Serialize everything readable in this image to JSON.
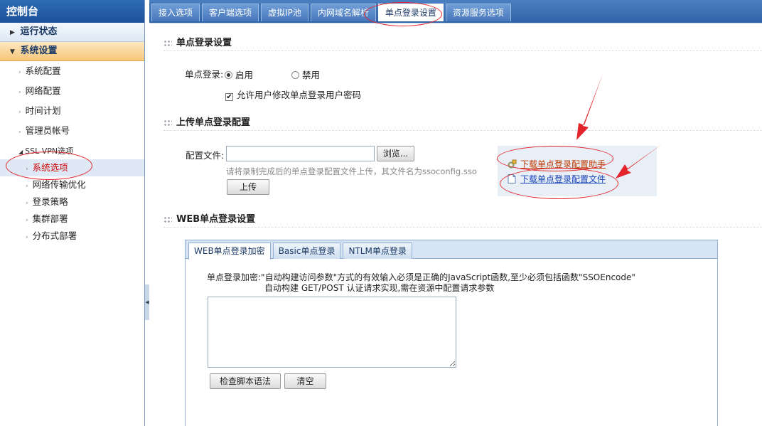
{
  "sidebar": {
    "title": "控制台",
    "section_status": "运行状态",
    "section_settings": "系统设置",
    "items": [
      "系统配置",
      "网络配置",
      "时间计划",
      "管理员帐号"
    ],
    "group_label": "SSL VPN选项",
    "sub_items": [
      "系统选项",
      "网络传输优化",
      "登录策略",
      "集群部署",
      "分布式部署"
    ]
  },
  "tabs": [
    "接入选项",
    "客户端选项",
    "虚拟IP池",
    "内网域名解析",
    "单点登录设置",
    "资源服务选项"
  ],
  "sso": {
    "section_title": "单点登录设置",
    "label": "单点登录:",
    "enable_label": "启用",
    "disable_label": "禁用",
    "selected": "启用",
    "allow_change_pwd": "允许用户修改单点登录用户密码"
  },
  "upload": {
    "section_title": "上传单点登录配置",
    "config_file_label": "配置文件:",
    "file_value": "",
    "browse_label": "浏览...",
    "hint": "请将录制完成后的单点登录配置文件上传，其文件名为ssoconfig.sso",
    "upload_label": "上传",
    "download_helper": "下载单点登录配置助手",
    "download_config": "下载单点登录配置文件"
  },
  "web_sso": {
    "section_title": "WEB单点登录设置",
    "tabs": [
      "WEB单点登录加密",
      "Basic单点登录",
      "NTLM单点登录"
    ],
    "note_line1": "单点登录加密:\"自动构建访问参数\"方式的有效输入必须是正确的JavaScript函数,至少必须包括函数\"SSOEncode\"",
    "note_line2": "自动构建 GET/POST 认证请求实现,需在资源中配置请求参数",
    "check_label": "检查脚本语法",
    "clear_label": "清空"
  },
  "colors": {
    "accent": "#2f63a8",
    "selected_text": "#cc0000",
    "annotation": "#e3242b",
    "download_helper_link": "#c03a00",
    "download_config_link": "#1a44b8"
  }
}
